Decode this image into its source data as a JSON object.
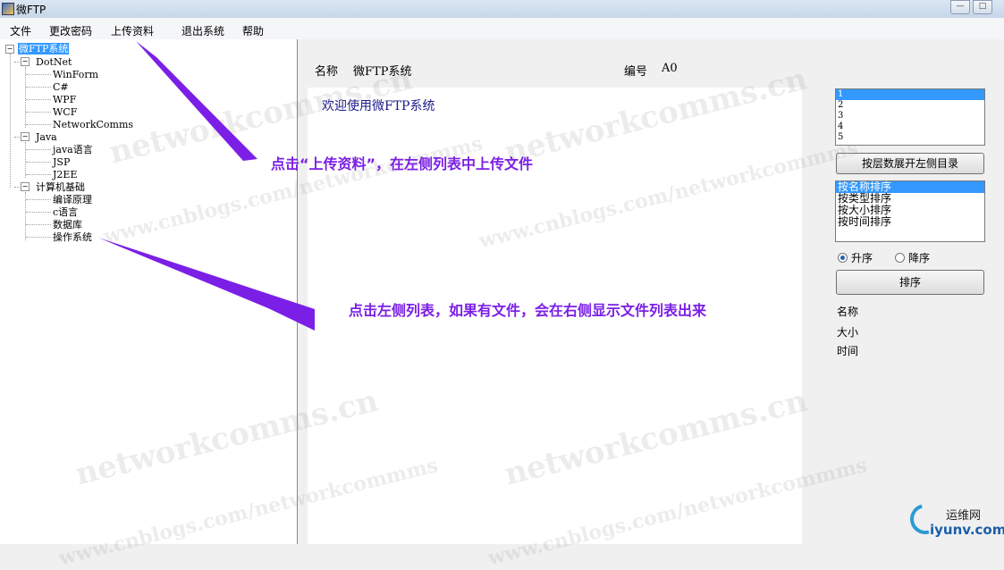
{
  "window": {
    "title": "微FTP",
    "controls": [
      "—",
      "□"
    ]
  },
  "menu": [
    "文件",
    "更改密码",
    "上传资料",
    "退出系统",
    "帮助"
  ],
  "tree": {
    "root": "微FTP系统",
    "groups": [
      {
        "label": "DotNet",
        "children": [
          "WinForm",
          "C#",
          "WPF",
          "WCF",
          "NetworkComms"
        ]
      },
      {
        "label": "Java",
        "children": [
          "java语言",
          "JSP",
          "J2EE"
        ]
      },
      {
        "label": "计算机基础",
        "children": [
          "编译原理",
          "c语言",
          "数据库",
          "操作系统"
        ]
      }
    ]
  },
  "info": {
    "name_label": "名称",
    "name_value": "微FTP系统",
    "id_label": "编号",
    "id_value": "A0"
  },
  "content": {
    "welcome": "欢迎使用微FTP系统"
  },
  "levels_list": {
    "items": [
      "1",
      "2",
      "3",
      "4",
      "5"
    ],
    "selected": 0
  },
  "expand_button": "按层数展开左侧目录",
  "sort_list": {
    "items": [
      "按名称排序",
      "按类型排序",
      "按大小排序",
      "按时间排序"
    ],
    "selected": 0
  },
  "order": {
    "asc": "升序",
    "desc": "降序",
    "selected": "asc"
  },
  "sort_button": "排序",
  "file_meta": {
    "name": "名称",
    "size": "大小",
    "time": "时间"
  },
  "annotations": {
    "upload": "点击“上传资料”，在左侧列表中上传文件",
    "list": "点击左侧列表，如果有文件，会在右侧显示文件列表出来"
  },
  "annotation_color": "#7b1fe6",
  "watermarks": [
    "networkcomms.cn",
    "www.cnblogs.com/networkcommms"
  ],
  "logo": {
    "cn": "运维网",
    "en": "iyunv.com"
  }
}
